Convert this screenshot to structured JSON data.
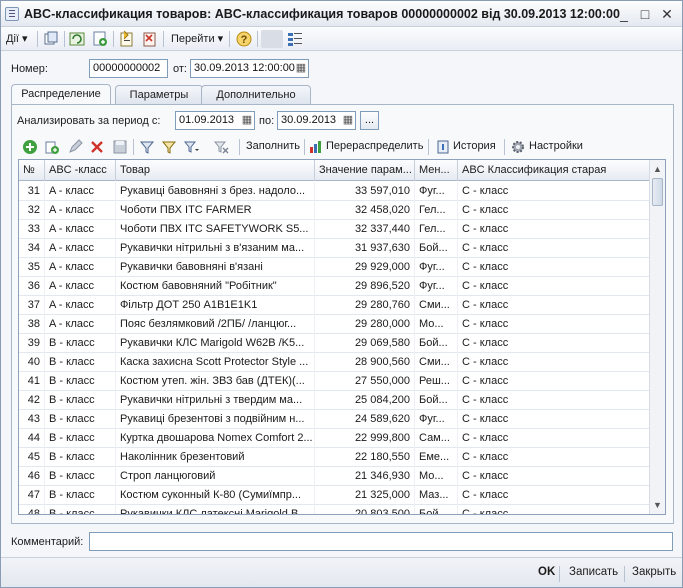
{
  "window": {
    "title": "ABC-классификация товаров: ABC-классификация товаров 00000000002 від 30.09.2013 12:00:00",
    "minimize": "_",
    "maximize": "□",
    "close": "✕"
  },
  "toolbar": {
    "actions_label": "Дії",
    "goto_label": "Перейти",
    "help_icon": "help-icon"
  },
  "header": {
    "number_label": "Номер:",
    "number_value": "00000000002",
    "date_label": "от:",
    "date_value": "30.09.2013 12:00:00"
  },
  "tabs": [
    {
      "label": "Распределение"
    },
    {
      "label": "Параметры"
    },
    {
      "label": "Дополнительно"
    }
  ],
  "period": {
    "label": "Анализировать за период с:",
    "from": "01.09.2013",
    "to_label": "по:",
    "to": "30.09.2013",
    "ellipsis": "..."
  },
  "grid_toolbar": {
    "fill_label": "Заполнить",
    "redistribute_label": "Перераспределить",
    "history_label": "История",
    "settings_label": "Настройки"
  },
  "grid": {
    "columns": [
      "№",
      "ABC -класс",
      "Товар",
      "Значение парам...",
      "Мен...",
      "ABC Классификация старая"
    ],
    "rows": [
      {
        "no": "31",
        "cls": "A - класс",
        "item": "Рукавиці бавовняні з брез. надоло...",
        "value": "33 597,010",
        "mgr": "Фуг...",
        "old": "C - класс"
      },
      {
        "no": "32",
        "cls": "A - класс",
        "item": "Чоботи ПВХ ITC FARMER",
        "value": "32 458,020",
        "mgr": "Гел...",
        "old": "C - класс"
      },
      {
        "no": "33",
        "cls": "A - класс",
        "item": "Чоботи ПВХ ITC SAFETYWORK S5...",
        "value": "32 337,440",
        "mgr": "Гел...",
        "old": "C - класс"
      },
      {
        "no": "34",
        "cls": "A - класс",
        "item": "Рукавички нітрильні з в'язаним ма...",
        "value": "31 937,630",
        "mgr": "Бой...",
        "old": "C - класс"
      },
      {
        "no": "35",
        "cls": "A - класс",
        "item": "Рукавички бавовняні в'язані",
        "value": "29 929,000",
        "mgr": "Фуг...",
        "old": "C - класс"
      },
      {
        "no": "36",
        "cls": "A - класс",
        "item": "Костюм бавовняний \"Робітник\"",
        "value": "29 896,520",
        "mgr": "Фуг...",
        "old": "C - класс"
      },
      {
        "no": "37",
        "cls": "A - класс",
        "item": "Фільтр ДОТ 250 A1B1E1K1",
        "value": "29 280,760",
        "mgr": "Сми...",
        "old": "C - класс"
      },
      {
        "no": "38",
        "cls": "A - класс",
        "item": "Пояс безлямковий /2ПБ/ /ланцюг...",
        "value": "29 280,000",
        "mgr": "Мо...",
        "old": "C - класс"
      },
      {
        "no": "39",
        "cls": "B - класс",
        "item": "Рукавички КЛС Marigold W62B /K5...",
        "value": "29 069,580",
        "mgr": "Бой...",
        "old": "C - класс"
      },
      {
        "no": "40",
        "cls": "B - класс",
        "item": "Каска захисна Scott Protector Style ...",
        "value": "28 900,560",
        "mgr": "Сми...",
        "old": "C - класс"
      },
      {
        "no": "41",
        "cls": "B - класс",
        "item": "Костюм утеп. жін. ЗВЗ бав (ДТЕК)(...",
        "value": "27 550,000",
        "mgr": "Реш...",
        "old": "C - класс"
      },
      {
        "no": "42",
        "cls": "B - класс",
        "item": "Рукавички нітрильні з твердим ма...",
        "value": "25 084,200",
        "mgr": "Бой...",
        "old": "C - класс"
      },
      {
        "no": "43",
        "cls": "B - класс",
        "item": "Рукавиці брезентові з подвійним н...",
        "value": "24 589,620",
        "mgr": "Фуг...",
        "old": "C - класс"
      },
      {
        "no": "44",
        "cls": "B - класс",
        "item": "Куртка двошарова Nomex Comfort 2...",
        "value": "22 999,800",
        "mgr": "Сам...",
        "old": "C - класс"
      },
      {
        "no": "45",
        "cls": "B - класс",
        "item": "Наколінник брезентовий",
        "value": "22 180,550",
        "mgr": "Еме...",
        "old": "C - класс"
      },
      {
        "no": "46",
        "cls": "B - класс",
        "item": "Строп ланцюговий",
        "value": "21 346,930",
        "mgr": "Мо...",
        "old": "C - класс"
      },
      {
        "no": "47",
        "cls": "B - класс",
        "item": "Костюм суконный К-80 (Сумиїмпр...",
        "value": "21 325,000",
        "mgr": "Маз...",
        "old": "C - класс"
      },
      {
        "no": "48",
        "cls": "B - класс",
        "item": "Рукавички КЛС латексні Marigold B...",
        "value": "20 803,500",
        "mgr": "Бой...",
        "old": "C - класс"
      }
    ]
  },
  "comment": {
    "label": "Комментарий:",
    "value": ""
  },
  "footer": {
    "ok_label": "OK",
    "save_label": "Записать",
    "close_label": "Закрыть"
  }
}
